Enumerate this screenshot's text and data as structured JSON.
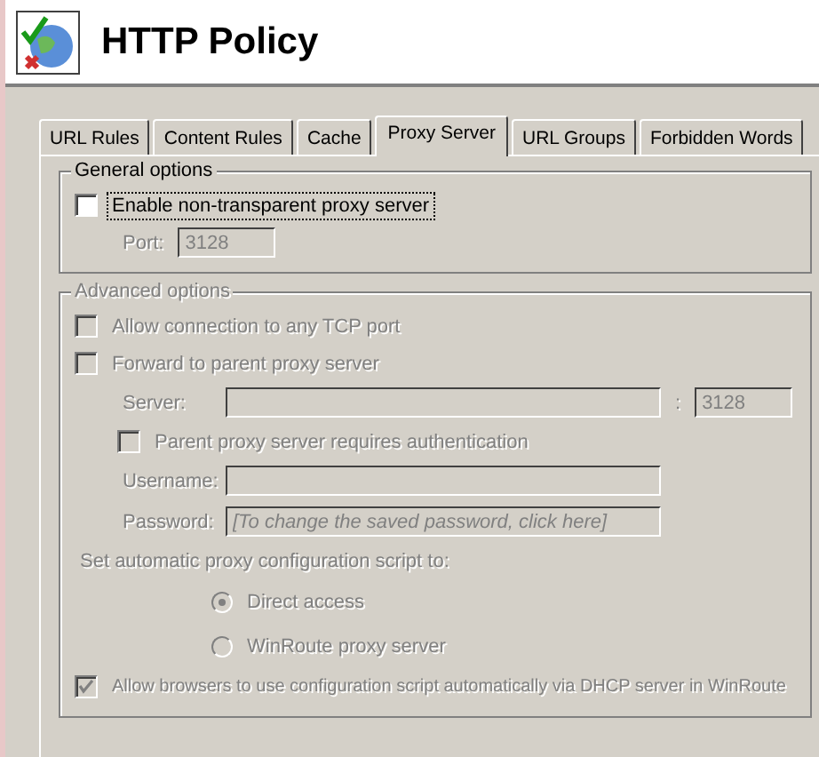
{
  "header": {
    "title": "HTTP Policy"
  },
  "tabs": [
    {
      "label": "URL Rules",
      "selected": false
    },
    {
      "label": "Content Rules",
      "selected": false
    },
    {
      "label": "Cache",
      "selected": false
    },
    {
      "label": "Proxy Server",
      "selected": true
    },
    {
      "label": "URL Groups",
      "selected": false
    },
    {
      "label": "Forbidden Words",
      "selected": false
    }
  ],
  "general": {
    "title": "General options",
    "enable_proxy": {
      "label": "Enable non-transparent proxy server",
      "checked": false,
      "focused": true
    },
    "port": {
      "label": "Port:",
      "value": "3128",
      "disabled": true
    }
  },
  "advanced": {
    "title": "Advanced options",
    "disabled": true,
    "allow_any_port": {
      "label": "Allow connection to any TCP port",
      "checked": false
    },
    "forward_parent": {
      "label": "Forward to parent proxy server",
      "checked": false
    },
    "server": {
      "label": "Server:",
      "separator": ":",
      "port": "3128"
    },
    "auth": {
      "label": "Parent proxy server requires authentication",
      "checked": false
    },
    "username": {
      "label": "Username:"
    },
    "password": {
      "label": "Password:",
      "placeholder": "[To change the saved password, click here]"
    },
    "script_label": "Set automatic proxy configuration script to:",
    "script_options": [
      {
        "label": "Direct access",
        "selected": true
      },
      {
        "label": "WinRoute proxy server",
        "selected": false
      }
    ],
    "dhcp": {
      "label": "Allow browsers to use configuration script automatically via DHCP server in WinRoute",
      "checked": true
    }
  }
}
